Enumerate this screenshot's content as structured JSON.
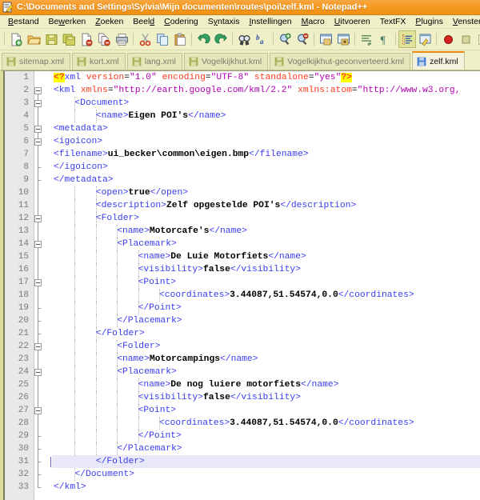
{
  "window": {
    "title": "C:\\Documents and Settings\\Sylvia\\Mijn documenten\\routes\\poi\\zelf.kml - Notepad++",
    "app_icon": "notepad-plus-plus-icon"
  },
  "menu": {
    "items": [
      {
        "label": "Bestand",
        "accel": "B"
      },
      {
        "label": "Bewerken",
        "accel": "w"
      },
      {
        "label": "Zoeken",
        "accel": "Z"
      },
      {
        "label": "Beeld",
        "accel": "d"
      },
      {
        "label": "Codering",
        "accel": "C"
      },
      {
        "label": "Syntaxis",
        "accel": "y"
      },
      {
        "label": "Instellingen",
        "accel": "I"
      },
      {
        "label": "Macro",
        "accel": "M"
      },
      {
        "label": "Uitvoeren",
        "accel": "U"
      },
      {
        "label": "TextFX",
        "accel": ""
      },
      {
        "label": "Plugins",
        "accel": "P"
      },
      {
        "label": "Vensters",
        "accel": "V"
      },
      {
        "label": "?",
        "accel": "?"
      }
    ]
  },
  "toolbar": {
    "buttons": [
      "new-file-icon",
      "open-folder-icon",
      "save-icon",
      "save-all-icon",
      "close-file-icon",
      "close-all-icon",
      "print-icon",
      "cut-icon",
      "copy-icon",
      "paste-icon",
      "undo-icon",
      "redo-icon",
      "find-icon",
      "replace-icon",
      "zoom-in-icon",
      "zoom-out-icon",
      "sync-vertical-icon",
      "sync-horizontal-icon",
      "word-wrap-icon",
      "show-all-chars-icon",
      "indent-guide-icon",
      "user-define-dialog-icon",
      "record-macro-icon",
      "stop-macro-icon",
      "play-macro-icon",
      "run-macro-multiple-icon"
    ]
  },
  "tabs": {
    "items": [
      {
        "label": "sitemap.xml",
        "active": false,
        "icon": "saved-file-icon"
      },
      {
        "label": "kort.xml",
        "active": false,
        "icon": "saved-file-icon"
      },
      {
        "label": "lang.xml",
        "active": false,
        "icon": "saved-file-icon"
      },
      {
        "label": "Vogelkijkhut.kml",
        "active": false,
        "icon": "saved-file-icon"
      },
      {
        "label": "Vogelkijkhut-geconverteerd.kml",
        "active": false,
        "icon": "saved-file-icon"
      },
      {
        "label": "zelf.kml",
        "active": true,
        "icon": "saved-file-icon"
      }
    ]
  },
  "editor": {
    "current_line": 31,
    "colors": {
      "tag": "#3a3af0",
      "attribute": "#ff3a1e",
      "value": "#b000b0",
      "text": "#000000",
      "pi_highlight": "#ffff00",
      "current_line_bg": "#e8e8f8",
      "gutter_bg": "#e8e8e8"
    },
    "lines": [
      {
        "n": 1,
        "indent": 0,
        "html": "<span class=\"pi\">&lt;?</span><span class=\"decl\">xml</span> <span class=\"attr\">version</span>=<span class=\"val\">\"1.0\"</span> <span class=\"attr\">encoding</span>=<span class=\"val\">\"UTF-8\"</span> <span class=\"attr\">standalone</span>=<span class=\"val\">\"yes\"</span><span class=\"pi\">?&gt;</span>",
        "plain": "<?xml version=\"1.0\" encoding=\"UTF-8\" standalone=\"yes\"?>"
      },
      {
        "n": 2,
        "indent": 0,
        "html": "<span class=\"tg\">&lt;kml</span> <span class=\"attr\">xmlns</span>=<span class=\"val\">\"http://earth.google.com/kml/2.2\"</span> <span class=\"attr\">xmlns:atom</span>=<span class=\"val\">\"http://www.w3.org,</span>",
        "plain": "<kml xmlns=\"http://earth.google.com/kml/2.2\" xmlns:atom=\"http://www.w3.org,"
      },
      {
        "n": 3,
        "indent": 4,
        "html": "<span class=\"tg\">&lt;Document&gt;</span>",
        "plain": "<Document>"
      },
      {
        "n": 4,
        "indent": 8,
        "html": "<span class=\"tg\">&lt;name&gt;</span><span class=\"txt\">Eigen POI's</span><span class=\"tg\">&lt;/name&gt;</span>",
        "plain": "<name>Eigen POI's</name>"
      },
      {
        "n": 5,
        "indent": 0,
        "html": "<span class=\"tg\">&lt;metadata&gt;</span>",
        "plain": "<metadata>"
      },
      {
        "n": 6,
        "indent": 0,
        "html": "<span class=\"tg\">&lt;igoicon&gt;</span>",
        "plain": "<igoicon>"
      },
      {
        "n": 7,
        "indent": 0,
        "html": "<span class=\"tg\">&lt;filename&gt;</span><span class=\"txt\">ui_becker\\common\\eigen.bmp</span><span class=\"tg\">&lt;/filename&gt;</span>",
        "plain": "<filename>ui_becker\\common\\eigen.bmp</filename>"
      },
      {
        "n": 8,
        "indent": 0,
        "html": "<span class=\"tg\">&lt;/igoicon&gt;</span>",
        "plain": "</igoicon>"
      },
      {
        "n": 9,
        "indent": 0,
        "html": "<span class=\"tg\">&lt;/metadata&gt;</span>",
        "plain": "</metadata>"
      },
      {
        "n": 10,
        "indent": 8,
        "html": "<span class=\"tg\">&lt;open&gt;</span><span class=\"txt\">true</span><span class=\"tg\">&lt;/open&gt;</span>",
        "plain": "<open>true</open>"
      },
      {
        "n": 11,
        "indent": 8,
        "html": "<span class=\"tg\">&lt;description&gt;</span><span class=\"txt\">Zelf opgestelde POI's</span><span class=\"tg\">&lt;/description&gt;</span>",
        "plain": "<description>Zelf opgestelde POI's</description>"
      },
      {
        "n": 12,
        "indent": 8,
        "html": "<span class=\"tg\">&lt;Folder&gt;</span>",
        "plain": "<Folder>"
      },
      {
        "n": 13,
        "indent": 12,
        "html": "<span class=\"tg\">&lt;name&gt;</span><span class=\"txt\">Motorcafe's</span><span class=\"tg\">&lt;/name&gt;</span>",
        "plain": "<name>Motorcafe's</name>"
      },
      {
        "n": 14,
        "indent": 12,
        "html": "<span class=\"tg\">&lt;Placemark&gt;</span>",
        "plain": "<Placemark>"
      },
      {
        "n": 15,
        "indent": 16,
        "html": "<span class=\"tg\">&lt;name&gt;</span><span class=\"txt\">De Luie Motorfiets</span><span class=\"tg\">&lt;/name&gt;</span>",
        "plain": "<name>De Luie Motorfiets</name>"
      },
      {
        "n": 16,
        "indent": 16,
        "html": "<span class=\"tg\">&lt;visibility&gt;</span><span class=\"txt\">false</span><span class=\"tg\">&lt;/visibility&gt;</span>",
        "plain": "<visibility>false</visibility>"
      },
      {
        "n": 17,
        "indent": 16,
        "html": "<span class=\"tg\">&lt;Point&gt;</span>",
        "plain": "<Point>"
      },
      {
        "n": 18,
        "indent": 20,
        "html": "<span class=\"tg\">&lt;coordinates&gt;</span><span class=\"txt\">3.44087,51.54574,0.0</span><span class=\"tg\">&lt;/coordinates&gt;</span>",
        "plain": "<coordinates>3.44087,51.54574,0.0</coordinates>"
      },
      {
        "n": 19,
        "indent": 16,
        "html": "<span class=\"tg\">&lt;/Point&gt;</span>",
        "plain": "</Point>"
      },
      {
        "n": 20,
        "indent": 12,
        "html": "<span class=\"tg\">&lt;/Placemark&gt;</span>",
        "plain": "</Placemark>"
      },
      {
        "n": 21,
        "indent": 8,
        "html": "<span class=\"tg\">&lt;/Folder&gt;</span>",
        "plain": "</Folder>"
      },
      {
        "n": 22,
        "indent": 12,
        "html": "<span class=\"tg\">&lt;Folder&gt;</span>",
        "plain": "<Folder>"
      },
      {
        "n": 23,
        "indent": 12,
        "html": "<span class=\"tg\">&lt;name&gt;</span><span class=\"txt\">Motorcampings</span><span class=\"tg\">&lt;/name&gt;</span>",
        "plain": "<name>Motorcampings</name>"
      },
      {
        "n": 24,
        "indent": 12,
        "html": "<span class=\"tg\">&lt;Placemark&gt;</span>",
        "plain": "<Placemark>"
      },
      {
        "n": 25,
        "indent": 16,
        "html": "<span class=\"tg\">&lt;name&gt;</span><span class=\"txt\">De nog luiere motorfiets</span><span class=\"tg\">&lt;/name&gt;</span>",
        "plain": "<name>De nog luiere motorfiets</name>"
      },
      {
        "n": 26,
        "indent": 16,
        "html": "<span class=\"tg\">&lt;visibility&gt;</span><span class=\"txt\">false</span><span class=\"tg\">&lt;/visibility&gt;</span>",
        "plain": "<visibility>false</visibility>"
      },
      {
        "n": 27,
        "indent": 16,
        "html": "<span class=\"tg\">&lt;Point&gt;</span>",
        "plain": "<Point>"
      },
      {
        "n": 28,
        "indent": 20,
        "html": "<span class=\"tg\">&lt;coordinates&gt;</span><span class=\"txt\">3.44087,51.54574,0.0</span><span class=\"tg\">&lt;/coordinates&gt;</span>",
        "plain": "<coordinates>3.44087,51.54574,0.0</coordinates>"
      },
      {
        "n": 29,
        "indent": 16,
        "html": "<span class=\"tg\">&lt;/Point&gt;</span>",
        "plain": "</Point>"
      },
      {
        "n": 30,
        "indent": 12,
        "html": "<span class=\"tg\">&lt;/Placemark&gt;</span>",
        "plain": "</Placemark>"
      },
      {
        "n": 31,
        "indent": 8,
        "html": "<span class=\"tg\">&lt;/Folder&gt;</span>",
        "plain": "</Folder>"
      },
      {
        "n": 32,
        "indent": 4,
        "html": "<span class=\"tg\">&lt;/Document&gt;</span>",
        "plain": "</Document>"
      },
      {
        "n": 33,
        "indent": 0,
        "html": "<span class=\"tg\">&lt;/kml&gt;</span>",
        "plain": "</kml>"
      }
    ],
    "fold_points": [
      2,
      3,
      5,
      6,
      12,
      14,
      17,
      22,
      24,
      27
    ],
    "fold_ends": [
      8,
      9,
      19,
      20,
      21,
      29,
      30,
      31,
      32,
      33
    ]
  }
}
